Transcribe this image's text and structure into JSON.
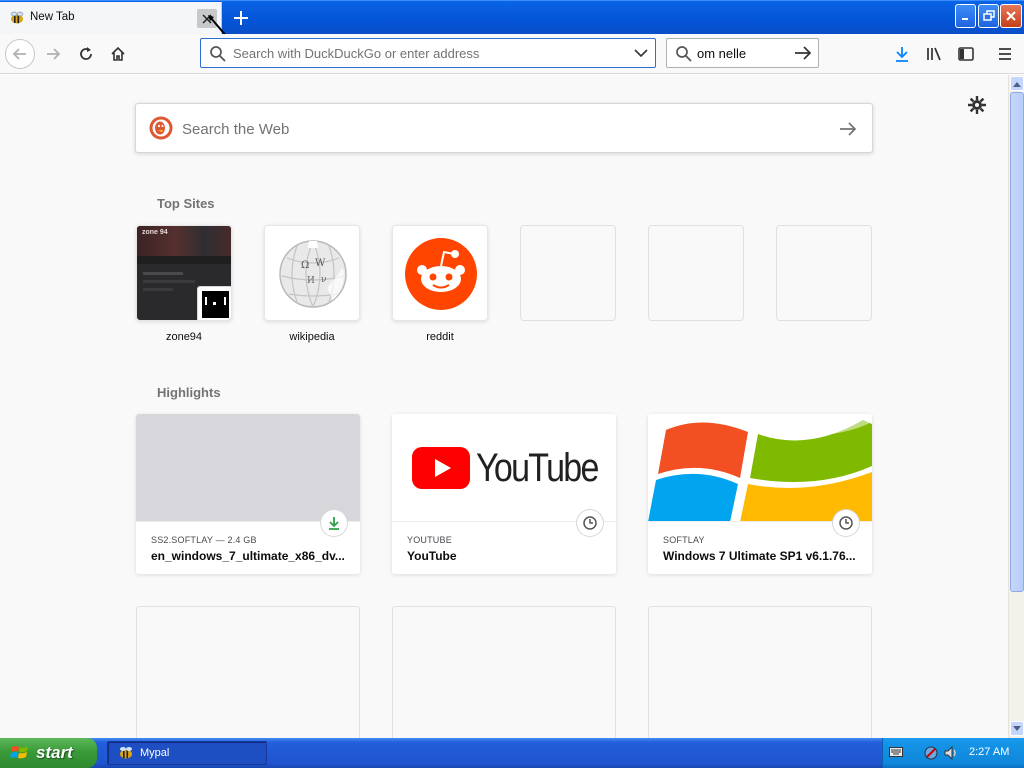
{
  "browser": {
    "tab": {
      "title": "New Tab",
      "favicon": "bee-icon"
    },
    "urlbar": {
      "placeholder": "Search with DuckDuckGo or enter address",
      "value": ""
    },
    "searchbar": {
      "value": "om nelle"
    }
  },
  "newtab": {
    "web_search": {
      "placeholder": "Search the Web"
    },
    "top_sites": {
      "title": "Top Sites",
      "items": [
        {
          "label": "zone94",
          "screenshot_text": "zone 94"
        },
        {
          "label": "wikipedia"
        },
        {
          "label": "reddit"
        },
        {
          "label": ""
        },
        {
          "label": ""
        },
        {
          "label": ""
        }
      ]
    },
    "highlights": {
      "title": "Highlights",
      "items": [
        {
          "source": "SS2.SOFTLAY — 2.4 GB",
          "title": "en_windows_7_ultimate_x86_dv...",
          "badge": "download-icon"
        },
        {
          "source": "YOUTUBE",
          "title": "YouTube",
          "badge": "clock-icon",
          "image_text": "YouTube"
        },
        {
          "source": "SOFTLAY",
          "title": "Windows 7 Ultimate SP1 v6.1.76...",
          "badge": "clock-icon"
        }
      ]
    }
  },
  "taskbar": {
    "start_label": "start",
    "items": [
      {
        "label": "Mypal"
      }
    ],
    "clock": "2:27 AM"
  },
  "colors": {
    "titlebar": "#0454d6",
    "accent_blue": "#0a84ff",
    "download_green": "#30a04a",
    "reddit_orange": "#ff4500",
    "youtube_red": "#ff0000"
  }
}
